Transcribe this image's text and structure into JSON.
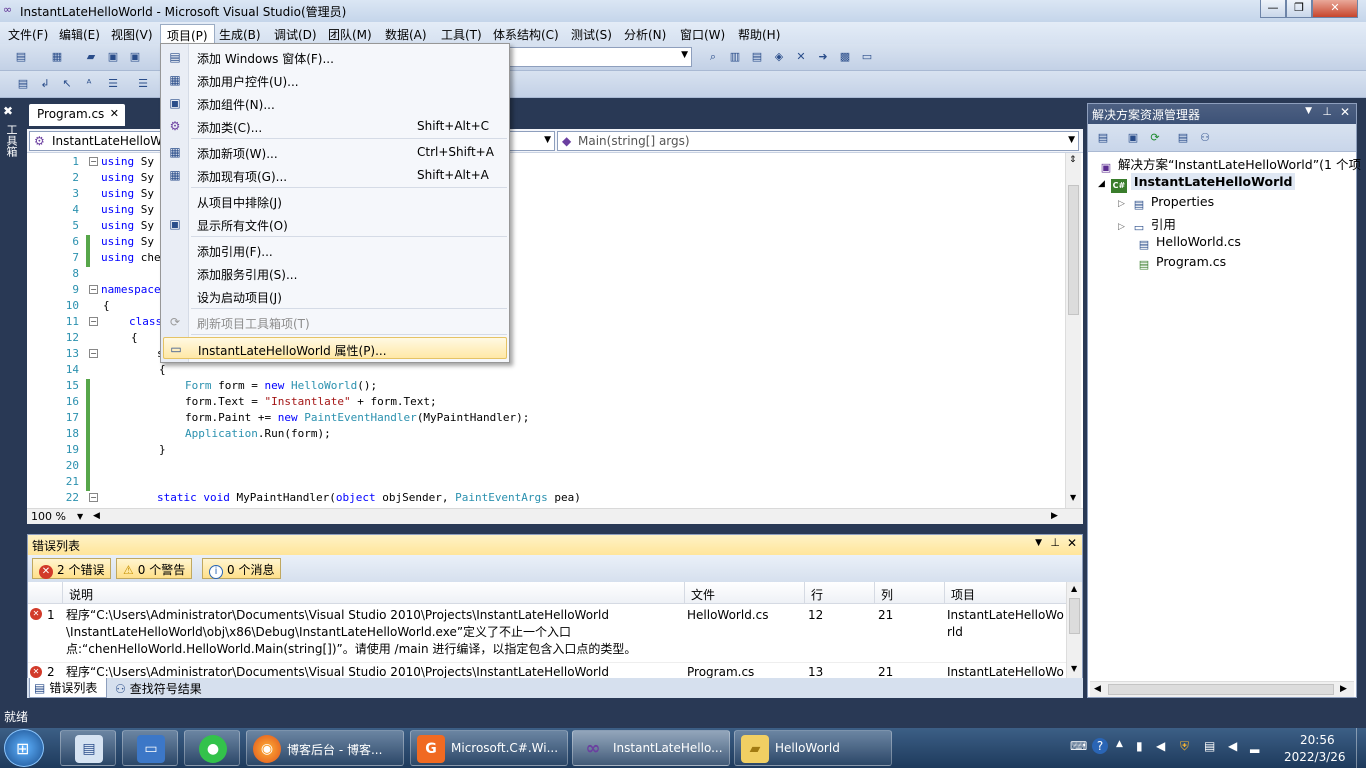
{
  "window": {
    "title": "InstantLateHelloWorld - Microsoft Visual Studio(管理员)",
    "controls": {
      "minimize": "—",
      "maximize": "❐",
      "close": "✕"
    }
  },
  "menubar": [
    "文件(F)",
    "编辑(E)",
    "视图(V)",
    "项目(P)",
    "生成(B)",
    "调试(D)",
    "团队(M)",
    "数据(A)",
    "工具(T)",
    "体系结构(C)",
    "测试(S)",
    "分析(N)",
    "窗口(W)",
    "帮助(H)"
  ],
  "toolbox_strip": {
    "label": "工具箱"
  },
  "editor": {
    "tab_label": "Program.cs",
    "tab_close": "✕",
    "nav_left": "InstantLateHelloWo",
    "nav_right": "Main(string[] args)",
    "zoom": "100 %",
    "line_numbers": [
      "1",
      "2",
      "3",
      "4",
      "5",
      "6",
      "7",
      "8",
      "9",
      "10",
      "11",
      "12",
      "13",
      "14",
      "15",
      "16",
      "17",
      "18",
      "19",
      "20",
      "21",
      "22"
    ],
    "lines": {
      "l1": {
        "kw": "using",
        "rest": " Sy"
      },
      "l2": {
        "kw": "using",
        "rest": " Sy"
      },
      "l3": {
        "kw": "using",
        "rest": " Sy"
      },
      "l4": {
        "kw": "using",
        "rest": " Sy"
      },
      "l5": {
        "kw": "using",
        "rest": " Sy"
      },
      "l6": {
        "kw": "using",
        "rest": " Sy"
      },
      "l7": {
        "kw": "using",
        "rest": " che"
      },
      "l9": {
        "kw": "namespace",
        "rest": ""
      },
      "l10": "{",
      "l11": {
        "kw": "class",
        "rest": ""
      },
      "l12": "{",
      "l13": "s",
      "l14": "{",
      "l15": {
        "t1": "Form",
        "m1": " form = ",
        "k1": "new",
        "sp": " ",
        "t2": "HelloWorld",
        "end": "();"
      },
      "l16": {
        "a": "form.Text = ",
        "s": "\"Instantlate\"",
        "b": " + form.Text;"
      },
      "l17": {
        "a": "form.Paint += ",
        "k": "new",
        "sp": " ",
        "t": "PaintEventHandler",
        "b": "(MyPaintHandler);"
      },
      "l18": {
        "t": "Application",
        "b": ".Run(form);"
      },
      "l19": "}",
      "l22": {
        "k1": "static",
        "sp1": " ",
        "k2": "void",
        "m": " MyPaintHandler(",
        "k3": "object",
        "m2": " objSender, ",
        "t": "PaintEventArgs",
        "e": " pea)"
      }
    }
  },
  "project_menu": {
    "items": [
      {
        "label": "添加 Windows 窗体(F)...",
        "shortcut": "",
        "icon": "form-icon"
      },
      {
        "label": "添加用户控件(U)...",
        "shortcut": "",
        "icon": "usercontrol-icon"
      },
      {
        "label": "添加组件(N)...",
        "shortcut": "",
        "icon": "component-icon"
      },
      {
        "label": "添加类(C)...",
        "shortcut": "Shift+Alt+C",
        "icon": "class-icon"
      },
      {
        "label": "添加新项(W)...",
        "shortcut": "Ctrl+Shift+A",
        "icon": "new-item-icon"
      },
      {
        "label": "添加现有项(G)...",
        "shortcut": "Shift+Alt+A",
        "icon": "existing-item-icon"
      },
      {
        "label": "从项目中排除(J)",
        "shortcut": "",
        "icon": ""
      },
      {
        "label": "显示所有文件(O)",
        "shortcut": "",
        "icon": "show-all-files-icon"
      },
      {
        "label": "添加引用(F)...",
        "shortcut": "",
        "icon": ""
      },
      {
        "label": "添加服务引用(S)...",
        "shortcut": "",
        "icon": ""
      },
      {
        "label": "设为启动项目(J)",
        "shortcut": "",
        "icon": ""
      },
      {
        "label": "刷新项目工具箱项(T)",
        "shortcut": "",
        "icon": "refresh-toolbox-icon",
        "disabled": true
      },
      {
        "label": "InstantLateHelloWorld 属性(P)...",
        "shortcut": "",
        "icon": "properties-icon",
        "highlighted": true
      }
    ]
  },
  "solution_explorer": {
    "title": "解决方案资源管理器",
    "solution": "解决方案“InstantLateHelloWorld”(1 个项",
    "project": "InstantLateHelloWorld",
    "properties": "Properties",
    "references": "引用",
    "file1": "HelloWorld.cs",
    "file2": "Program.cs"
  },
  "error_list": {
    "title": "错误列表",
    "filters": {
      "errors": "2 个错误",
      "warnings": "0 个警告",
      "messages": "0 个消息"
    },
    "columns": {
      "desc": "说明",
      "file": "文件",
      "line": "行",
      "col": "列",
      "project": "项目"
    },
    "rows": [
      {
        "num": "1",
        "desc": "程序“C:\\Users\\Administrator\\Documents\\Visual Studio 2010\\Projects\\InstantLateHelloWorld\n\\InstantLateHelloWorld\\obj\\x86\\Debug\\InstantLateHelloWorld.exe”定义了不止一个入口\n点:“chenHelloWorld.HelloWorld.Main(string[])”。请使用 /main 进行编译，以指定包含入口点的类型。",
        "file": "HelloWorld.cs",
        "line": "12",
        "col": "21",
        "project": "InstantLateHelloWo\nrld"
      },
      {
        "num": "2",
        "desc": "程序“C:\\Users\\Administrator\\Documents\\Visual Studio 2010\\Projects\\InstantLateHelloWorld",
        "file": "Program.cs",
        "line": "13",
        "col": "21",
        "project": "InstantLateHelloWo"
      }
    ],
    "bottom_tabs": {
      "errors": "错误列表",
      "find": "查找符号结果"
    }
  },
  "status": "就绪",
  "taskbar": {
    "items": [
      {
        "label": "博客后台 - 博客...",
        "icon": "firefox-icon"
      },
      {
        "label": "Microsoft.C#.Wi...",
        "icon": "pdf-icon"
      },
      {
        "label": "InstantLateHello...",
        "icon": "visual-studio-icon"
      },
      {
        "label": "HelloWorld",
        "icon": "folder-icon"
      }
    ],
    "time": "20:56",
    "date": "2022/3/26"
  }
}
